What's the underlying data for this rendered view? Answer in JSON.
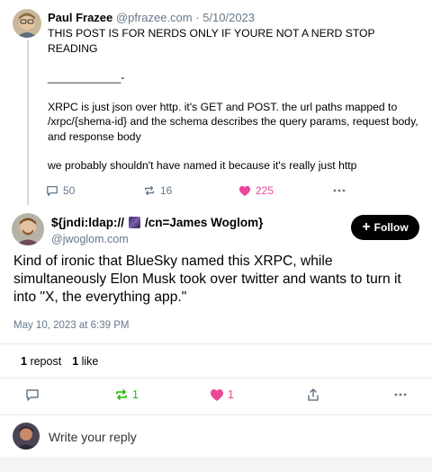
{
  "parent_post": {
    "author_name": "Paul Frazee",
    "author_handle": "@pfrazee.com",
    "separator": " · ",
    "date": "5/10/2023",
    "body": [
      "THIS POST IS FOR NERDS ONLY IF YOURE NOT A NERD STOP READING",
      "____________-",
      "XRPC is just json over http. it's GET and POST. the url paths mapped to /xrpc/{shema-id} and the schema describes the query params, request body, and response body",
      "we probably shouldn't have named it because it's really just http"
    ],
    "replies": "50",
    "reposts": "16",
    "likes": "225",
    "liked": true
  },
  "main_post": {
    "author_name_prefix": "${jndi:ldap://",
    "author_name_suffix": "/cn=James Woglom}",
    "author_handle": "@jwoglom.com",
    "follow_label": "Follow",
    "text": "Kind of ironic that BlueSky named this XRPC, while simultaneously Elon Musk took over twitter and wants to turn it into \"X, the everything app.\"",
    "timestamp": "May 10, 2023 at 6:39 PM",
    "stats": {
      "repost_count": "1",
      "repost_label": "repost",
      "like_count": "1",
      "like_label": "like"
    },
    "actions": {
      "reply_count": "",
      "repost_count": "1",
      "like_count": "1"
    }
  },
  "reply_box": {
    "placeholder": "Write your reply"
  },
  "colors": {
    "muted": "#66788a",
    "like_pink": "#ec4899",
    "repost_green": "#20bc07",
    "follow_bg": "#000000",
    "divider": "#e3e8ed"
  },
  "icons": {
    "reply": "speech-bubble-icon",
    "repost": "repost-arrows-icon",
    "like": "heart-icon",
    "share": "share-upload-icon",
    "more": "ellipsis-icon",
    "follow": "plus-icon"
  }
}
